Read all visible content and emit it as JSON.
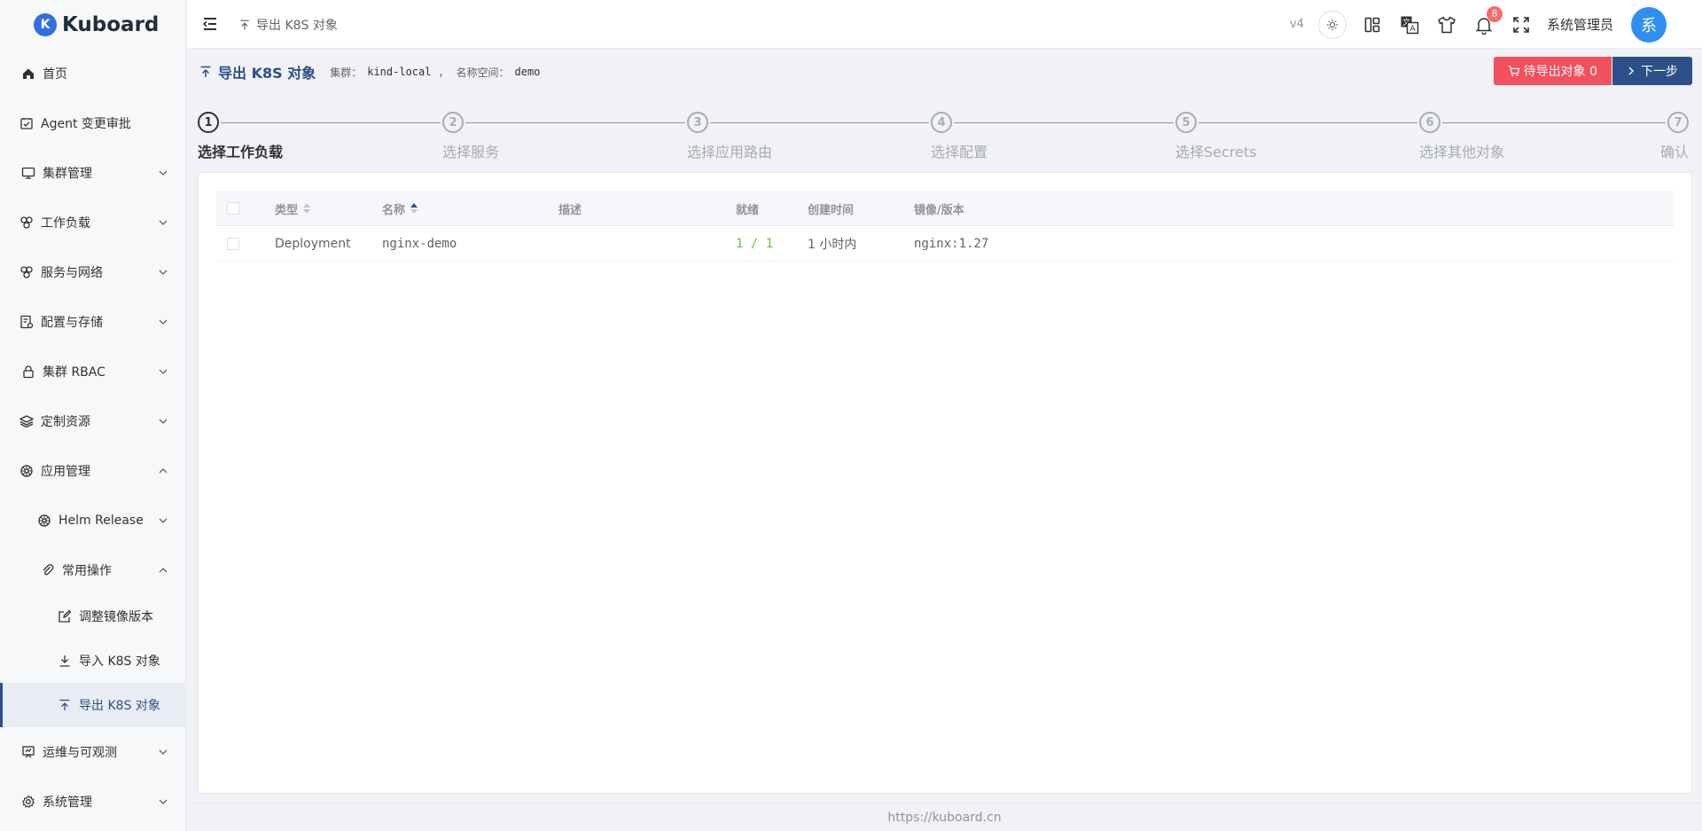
{
  "app": {
    "name": "Kuboard",
    "logo_letter": "K"
  },
  "sidebar": {
    "items": [
      {
        "label": "首页",
        "icon": "home-icon"
      },
      {
        "label": "Agent 变更审批",
        "icon": "approval-icon"
      },
      {
        "label": "集群管理",
        "icon": "monitor-icon",
        "expandable": true,
        "expanded": false
      },
      {
        "label": "工作负载",
        "icon": "workload-icon",
        "expandable": true,
        "expanded": false
      },
      {
        "label": "服务与网络",
        "icon": "network-icon",
        "expandable": true,
        "expanded": false
      },
      {
        "label": "配置与存储",
        "icon": "config-icon",
        "expandable": true,
        "expanded": false
      },
      {
        "label": "集群 RBAC",
        "icon": "lock-icon",
        "expandable": true,
        "expanded": false
      },
      {
        "label": "定制资源",
        "icon": "layers-icon",
        "expandable": true,
        "expanded": false
      },
      {
        "label": "应用管理",
        "icon": "helm-icon",
        "expandable": true,
        "expanded": true
      },
      {
        "label": "Helm Release",
        "icon": "helm-icon",
        "expandable": true,
        "expanded": false
      },
      {
        "label": "常用操作",
        "icon": "paperclip-icon",
        "expandable": true,
        "expanded": true
      },
      {
        "label": "调整镜像版本",
        "icon": "edit-icon"
      },
      {
        "label": "导入 K8S 对象",
        "icon": "download-icon"
      },
      {
        "label": "导出 K8S 对象",
        "icon": "upload-icon",
        "active": true
      },
      {
        "label": "运维与可观测",
        "icon": "dashboard-icon",
        "expandable": true,
        "expanded": false
      },
      {
        "label": "系统管理",
        "icon": "gear-icon",
        "expandable": true,
        "expanded": false
      }
    ]
  },
  "header": {
    "breadcrumb": "导出 K8S 对象",
    "version": "v4",
    "notification_count": "8",
    "user_name": "系统管理员",
    "avatar_text": "系"
  },
  "page": {
    "title": "导出 K8S 对象",
    "cluster_label": "集群：",
    "cluster_value": "kind-local",
    "separator": "，",
    "namespace_label": "名称空间：",
    "namespace_value": "demo",
    "pending_button": "待导出对象 0",
    "next_button": "下一步"
  },
  "steps": [
    {
      "num": "1",
      "label": "选择工作负载",
      "active": true
    },
    {
      "num": "2",
      "label": "选择服务"
    },
    {
      "num": "3",
      "label": "选择应用路由"
    },
    {
      "num": "4",
      "label": "选择配置"
    },
    {
      "num": "5",
      "label": "选择Secrets"
    },
    {
      "num": "6",
      "label": "选择其他对象"
    },
    {
      "num": "7",
      "label": "确认"
    }
  ],
  "table": {
    "columns": [
      "类型",
      "名称",
      "描述",
      "就绪",
      "创建时间",
      "镜像/版本"
    ],
    "rows": [
      {
        "type": "Deployment",
        "name": "nginx-demo",
        "desc": "",
        "ready": "1 / 1",
        "created": "1 小时内",
        "image": "nginx:1.27"
      }
    ]
  },
  "footer": {
    "url": "https://kuboard.cn"
  },
  "colors": {
    "accent": "#2d4f8a",
    "danger": "#f2505d",
    "ready": "#67c23a",
    "avatar": "#2f8ff0"
  }
}
